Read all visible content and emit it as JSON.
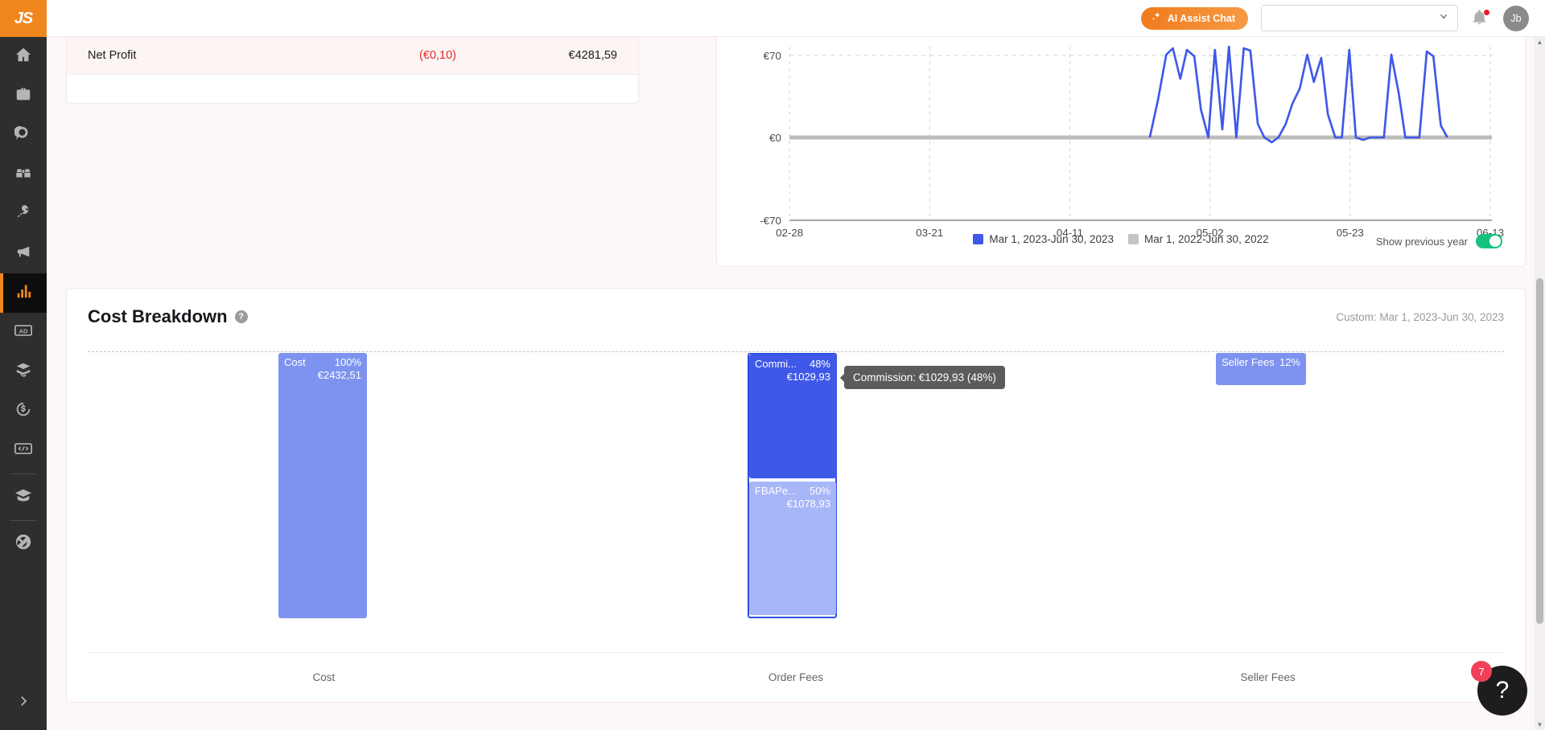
{
  "sidebar": {
    "logo": "JS",
    "items": [
      {
        "name": "home",
        "label": "Home"
      },
      {
        "name": "product-database",
        "label": "Product Database"
      },
      {
        "name": "opportunity-finder",
        "label": "Opportunity Finder"
      },
      {
        "name": "keyword-scout",
        "label": "Keyword Scout"
      },
      {
        "name": "keyword-tool",
        "label": "Keyword Tool"
      },
      {
        "name": "promotions",
        "label": "Promotions"
      },
      {
        "name": "analytics",
        "label": "Analytics"
      },
      {
        "name": "advertising",
        "label": "Advertising"
      },
      {
        "name": "inventory",
        "label": "Inventory"
      },
      {
        "name": "refunds",
        "label": "Refunds"
      },
      {
        "name": "developer",
        "label": "Developer"
      },
      {
        "name": "academy",
        "label": "Academy"
      },
      {
        "name": "partners",
        "label": "Partners"
      }
    ],
    "expand_label": "Expand menu"
  },
  "header": {
    "ai_button_label": "AI Assist Chat",
    "account_select_value": "",
    "notification_count": "",
    "avatar_initials": "Jb"
  },
  "kpi": {
    "label": "Net Profit",
    "change_value": "(€0,10)",
    "total_value": "€4281,59"
  },
  "line_chart": {
    "legend": [
      {
        "label": "Mar 1, 2023-Jun 30, 2023",
        "color": "#3f58e8"
      },
      {
        "label": "Mar 1, 2022-Jun 30, 2022",
        "color": "#c4c4c4"
      }
    ],
    "toggle_label": "Show previous year",
    "toggle_on": true,
    "chart_data": {
      "type": "line",
      "title": "",
      "xlabel": "",
      "ylabel": "",
      "ylim": [
        -70,
        70
      ],
      "yticks": [
        "€70",
        "€0",
        "-€70"
      ],
      "ytick_values": [
        70,
        0,
        -70
      ],
      "xticks": [
        "02-28",
        "03-21",
        "04-11",
        "05-02",
        "05-23",
        "06-13"
      ],
      "grid": true,
      "legend_position": "bottom-center",
      "series": [
        {
          "name": "Mar 1, 2023-Jun 30, 2023",
          "color": "#3f58e8",
          "x": [
            56,
            57,
            58,
            59,
            60,
            61,
            62,
            63,
            64,
            65,
            66,
            67,
            68,
            69,
            70,
            71,
            72,
            73,
            74,
            75,
            76,
            77,
            78,
            79,
            80,
            81,
            82,
            83,
            84,
            85,
            86,
            87,
            88,
            89,
            90,
            91,
            92,
            93,
            94,
            95,
            96,
            97,
            98,
            99,
            100
          ],
          "values": [
            0,
            0,
            38,
            65,
            72,
            42,
            70,
            66,
            25,
            0,
            70,
            8,
            72,
            0,
            72,
            70,
            10,
            0,
            0,
            -4,
            0,
            10,
            30,
            44,
            68,
            40,
            66,
            20,
            0,
            0,
            70,
            0,
            -2,
            0,
            0,
            0,
            66,
            38,
            0,
            0,
            0,
            70,
            68,
            8,
            0
          ]
        },
        {
          "name": "Mar 1, 2022-Jun 30, 2022",
          "color": "#c4c4c4",
          "x": [
            0,
            100
          ],
          "values": [
            0,
            0
          ]
        }
      ]
    }
  },
  "cost_breakdown": {
    "title": "Cost Breakdown",
    "help_icon": "question-mark-icon",
    "date_range": "Custom: Mar 1, 2023-Jun 30, 2023",
    "tooltip": "Commission: €1029,93 (48%)",
    "axis_labels": [
      "Cost",
      "Order Fees",
      "Seller Fees"
    ],
    "chart_data": {
      "type": "bar",
      "title": "Cost Breakdown",
      "categories": [
        "Cost",
        "Order Fees",
        "Seller Fees"
      ],
      "ylabel": "",
      "xlabel": "",
      "tiles": [
        {
          "group": "Cost",
          "label": "Cost",
          "label_full": "Cost",
          "percent": "100%",
          "percent_value": 100,
          "value": "€2432,51",
          "value_number": 2432.51,
          "color": "#7e93ef"
        },
        {
          "group": "Order Fees",
          "label": "Commi...",
          "label_full": "Commission",
          "percent": "48%",
          "percent_value": 48,
          "value": "€1029,93",
          "value_number": 1029.93,
          "color": "#3f58e8"
        },
        {
          "group": "Order Fees",
          "label": "FBAPe...",
          "label_full": "FBAPerUnitFulfillmentFee",
          "percent": "50%",
          "percent_value": 50,
          "value": "€1078,93",
          "value_number": 1078.93,
          "color": "#a6b6f7"
        },
        {
          "group": "Seller Fees",
          "label": "Seller Fees",
          "label_full": "Seller Fees",
          "percent": "12%",
          "percent_value": 12,
          "value": "",
          "value_number": null,
          "color": "#7e93ef"
        }
      ]
    }
  },
  "help_fab": {
    "icon": "question-mark-icon",
    "badge": "7"
  }
}
